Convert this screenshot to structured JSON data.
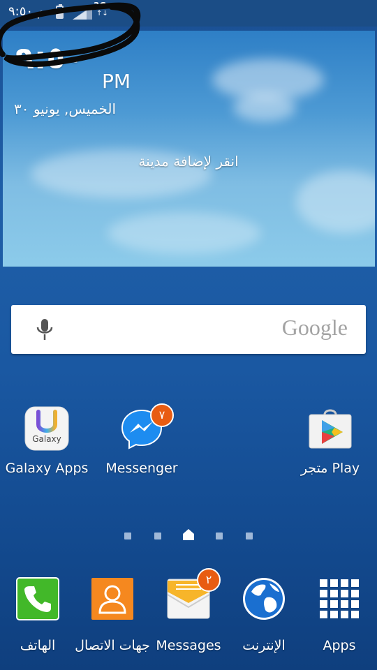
{
  "status_bar": {
    "time": "م ٩:٥٠",
    "network": "3G",
    "network_arrows": "↑↓"
  },
  "weather_widget": {
    "time": "٩:٥٠",
    "ampm": "PM",
    "date": "الخميس, يونيو ٣٠",
    "add_city": "انقر لإضافة مدينة"
  },
  "search_bar": {
    "logo": "Google",
    "mic_icon": "microphone-icon"
  },
  "home_apps": [
    {
      "label": "Galaxy Apps",
      "icon_text": "Galaxy"
    },
    {
      "label": "Messenger",
      "badge": "٧"
    },
    {
      "label": "متجر Play"
    }
  ],
  "page_indicator": {
    "count": 5,
    "home_index": 2
  },
  "dock": [
    {
      "label": "الهاتف"
    },
    {
      "label": "جهات الاتصال"
    },
    {
      "label": "Messages",
      "badge": "٢"
    },
    {
      "label": "الإنترنت"
    },
    {
      "label": "Apps"
    }
  ],
  "colors": {
    "badge": "#e85c12",
    "background": "#1a58a2"
  }
}
